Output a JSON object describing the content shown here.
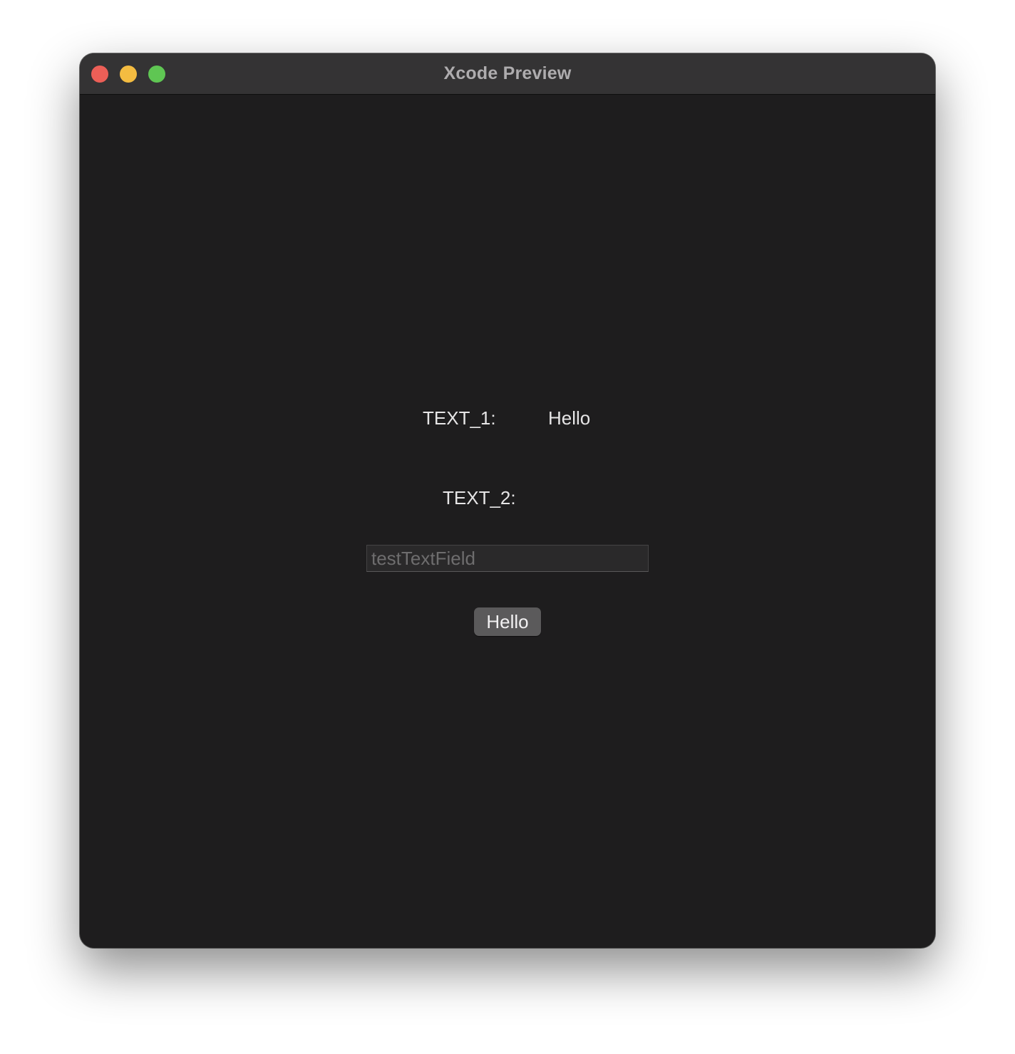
{
  "window": {
    "title": "Xcode Preview",
    "traffic_lights": {
      "close_color": "#ec5f57",
      "minimize_color": "#f4bc41",
      "maximize_color": "#5fc653"
    }
  },
  "content": {
    "text1_label": "TEXT_1:",
    "text1_value": "Hello",
    "text2_label": "TEXT_2:",
    "text_field": {
      "value": "",
      "placeholder": "testTextField"
    },
    "button_label": "Hello"
  }
}
